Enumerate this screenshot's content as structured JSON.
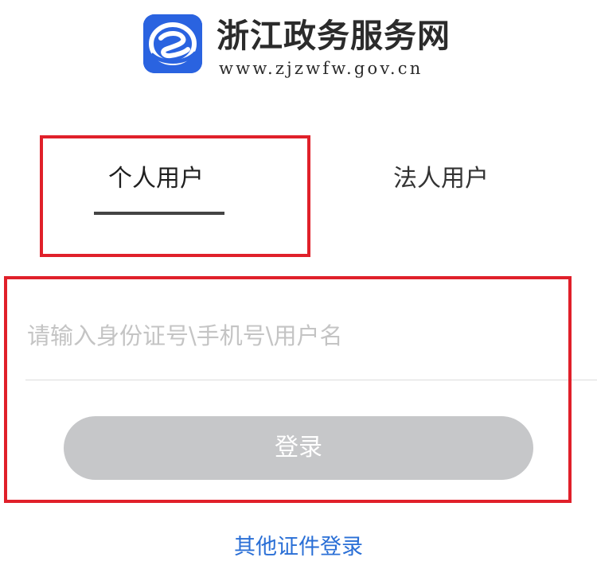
{
  "header": {
    "title": "浙江政务服务网",
    "url": "www.zjzwfw.gov.cn",
    "logo_icon": "zj-logo-icon",
    "logo_color": "#2a63e0"
  },
  "tabs": [
    {
      "label": "个人用户",
      "active": true
    },
    {
      "label": "法人用户",
      "active": false
    }
  ],
  "form": {
    "input_placeholder": "请输入身份证号\\手机号\\用户名",
    "input_value": "",
    "login_label": "登录"
  },
  "footer": {
    "other_login_label": "其他证件登录"
  },
  "colors": {
    "highlight": "#e0202a",
    "button_disabled": "#c6c7c9",
    "link": "#2a6fd6"
  }
}
